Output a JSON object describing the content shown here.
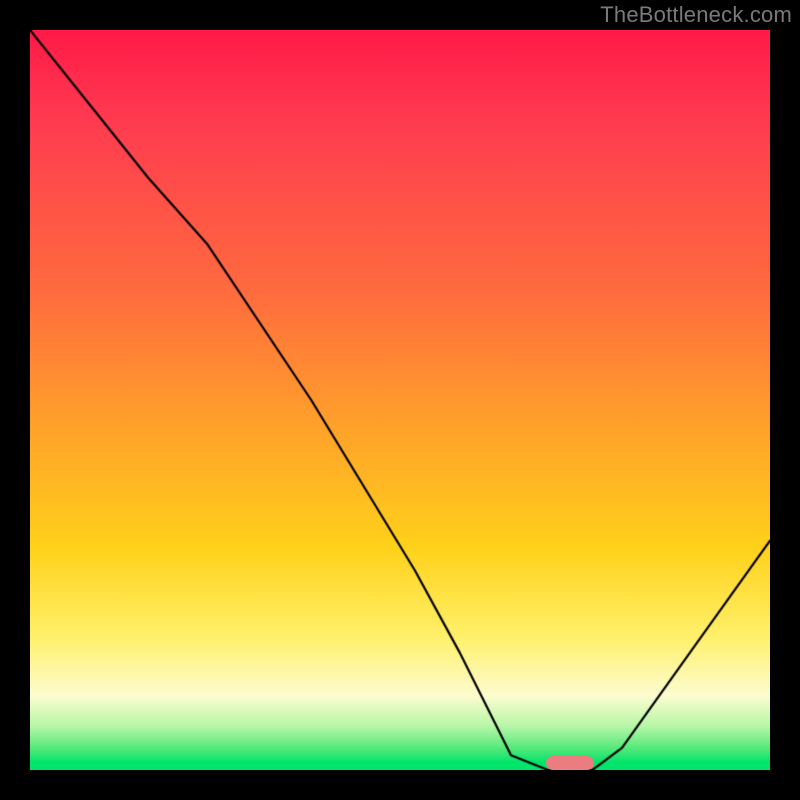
{
  "watermark_text": "TheBottleneck.com",
  "chart_data": {
    "type": "line",
    "title": "",
    "xlabel": "",
    "ylabel": "",
    "xlim": [
      0,
      100
    ],
    "ylim": [
      0,
      100
    ],
    "grid": false,
    "legend": false,
    "series": [
      {
        "name": "curve",
        "x": [
          0,
          8,
          16,
          24,
          38,
          52,
          58,
          63,
          65,
          70,
          76,
          80,
          90,
          100
        ],
        "values": [
          100,
          90,
          80,
          71,
          50,
          27,
          16,
          6,
          2,
          0,
          0,
          3,
          17,
          31
        ]
      }
    ],
    "marker": {
      "x_center": 73,
      "y": 0,
      "color": "#eb7d80",
      "width_pct": 6.5
    },
    "gradient_stops": [
      {
        "pct": 0,
        "color": "#ff1a47"
      },
      {
        "pct": 12,
        "color": "#ff3a50"
      },
      {
        "pct": 35,
        "color": "#ff6a3e"
      },
      {
        "pct": 55,
        "color": "#ffa528"
      },
      {
        "pct": 70,
        "color": "#ffd11a"
      },
      {
        "pct": 82,
        "color": "#fff06a"
      },
      {
        "pct": 90,
        "color": "#fcfccf"
      },
      {
        "pct": 94,
        "color": "#b8f7a8"
      },
      {
        "pct": 97,
        "color": "#57e97a"
      },
      {
        "pct": 100,
        "color": "#00e56a"
      }
    ]
  }
}
